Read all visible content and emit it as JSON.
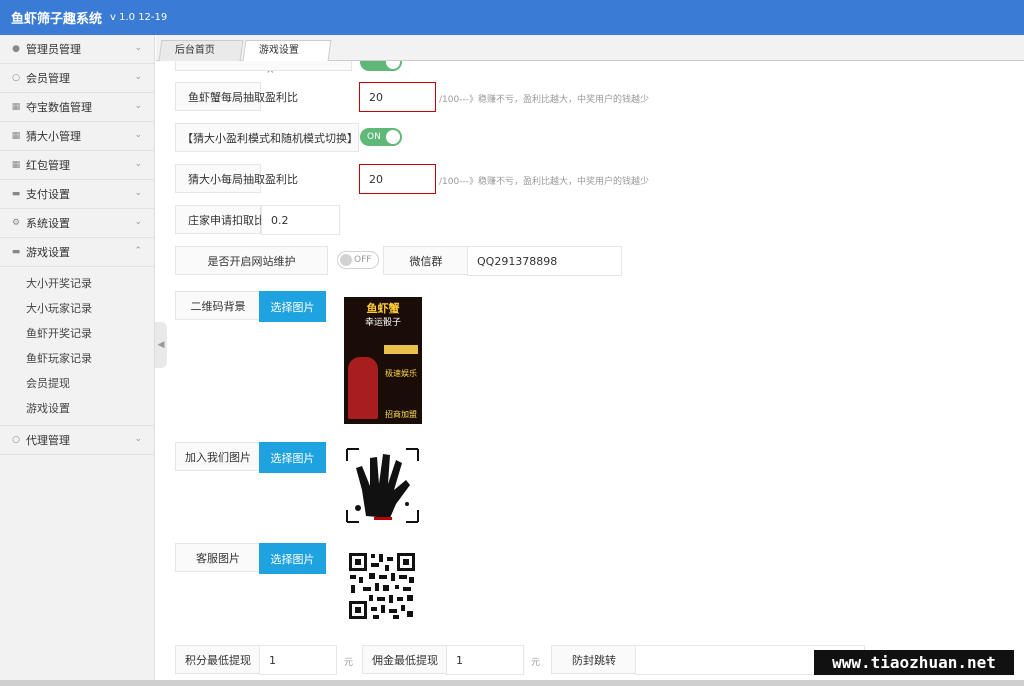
{
  "app": {
    "title": "鱼虾筛子趣系统",
    "version": "v 1.0 12-19"
  },
  "sidebar": {
    "items": [
      {
        "label": "管理员管理",
        "icon": "user-icon"
      },
      {
        "label": "会员管理",
        "icon": "member-icon"
      },
      {
        "label": "夺宝数值管理",
        "icon": "grid-icon"
      },
      {
        "label": "猜大小管理",
        "icon": "grid-icon"
      },
      {
        "label": "红包管理",
        "icon": "grid-icon"
      },
      {
        "label": "支付设置",
        "icon": "card-icon"
      },
      {
        "label": "系统设置",
        "icon": "gear-icon"
      },
      {
        "label": "游戏设置",
        "icon": "card-icon"
      }
    ],
    "sub_items": [
      "大小开奖记录",
      "大小玩家记录",
      "鱼虾开奖记录",
      "鱼虾玩家记录",
      "会员提现",
      "游戏设置"
    ],
    "last_item": {
      "label": "代理管理",
      "icon": "member-icon"
    }
  },
  "tabs": [
    {
      "label": "后台首页"
    },
    {
      "label": "游戏设置",
      "close": "×"
    }
  ],
  "form": {
    "fish_rate": {
      "label": "鱼虾蟹每局抽取盈利比",
      "value": "20",
      "hint": "/100---》稳赚不亏，盈利比越大，中奖用户的钱越少"
    },
    "mode_switch": {
      "label": "【猜大小盈利模式和随机模式切换】",
      "state": "ON"
    },
    "guess_rate": {
      "label": "猜大小每局抽取盈利比",
      "value": "20",
      "hint": "/100---》稳赚不亏，盈利比越大，中奖用户的钱越少"
    },
    "banker_fee": {
      "label": "庄家申请扣取比",
      "value": "0.2"
    },
    "maintenance": {
      "label": "是否开启网站维护",
      "state": "OFF"
    },
    "wechat": {
      "label": "微信群",
      "value": "QQ291378898"
    },
    "qr_bg": {
      "label": "二维码背景",
      "button": "选择图片"
    },
    "join_us": {
      "label": "加入我们图片",
      "button": "选择图片"
    },
    "service": {
      "label": "客服图片",
      "button": "选择图片"
    },
    "min_points": {
      "label": "积分最低提现",
      "value": "1",
      "unit": "元"
    },
    "min_commission": {
      "label": "佣金最低提现",
      "value": "1",
      "unit": "元"
    },
    "anti_block": {
      "label": "防封跳转",
      "value": ""
    }
  },
  "poster": {
    "line1": "鱼虾蟹",
    "line2": "幸运骰子",
    "line3": "极速娱乐",
    "line4": "招商加盟"
  },
  "watermark": "www.tiaozhuan.net"
}
